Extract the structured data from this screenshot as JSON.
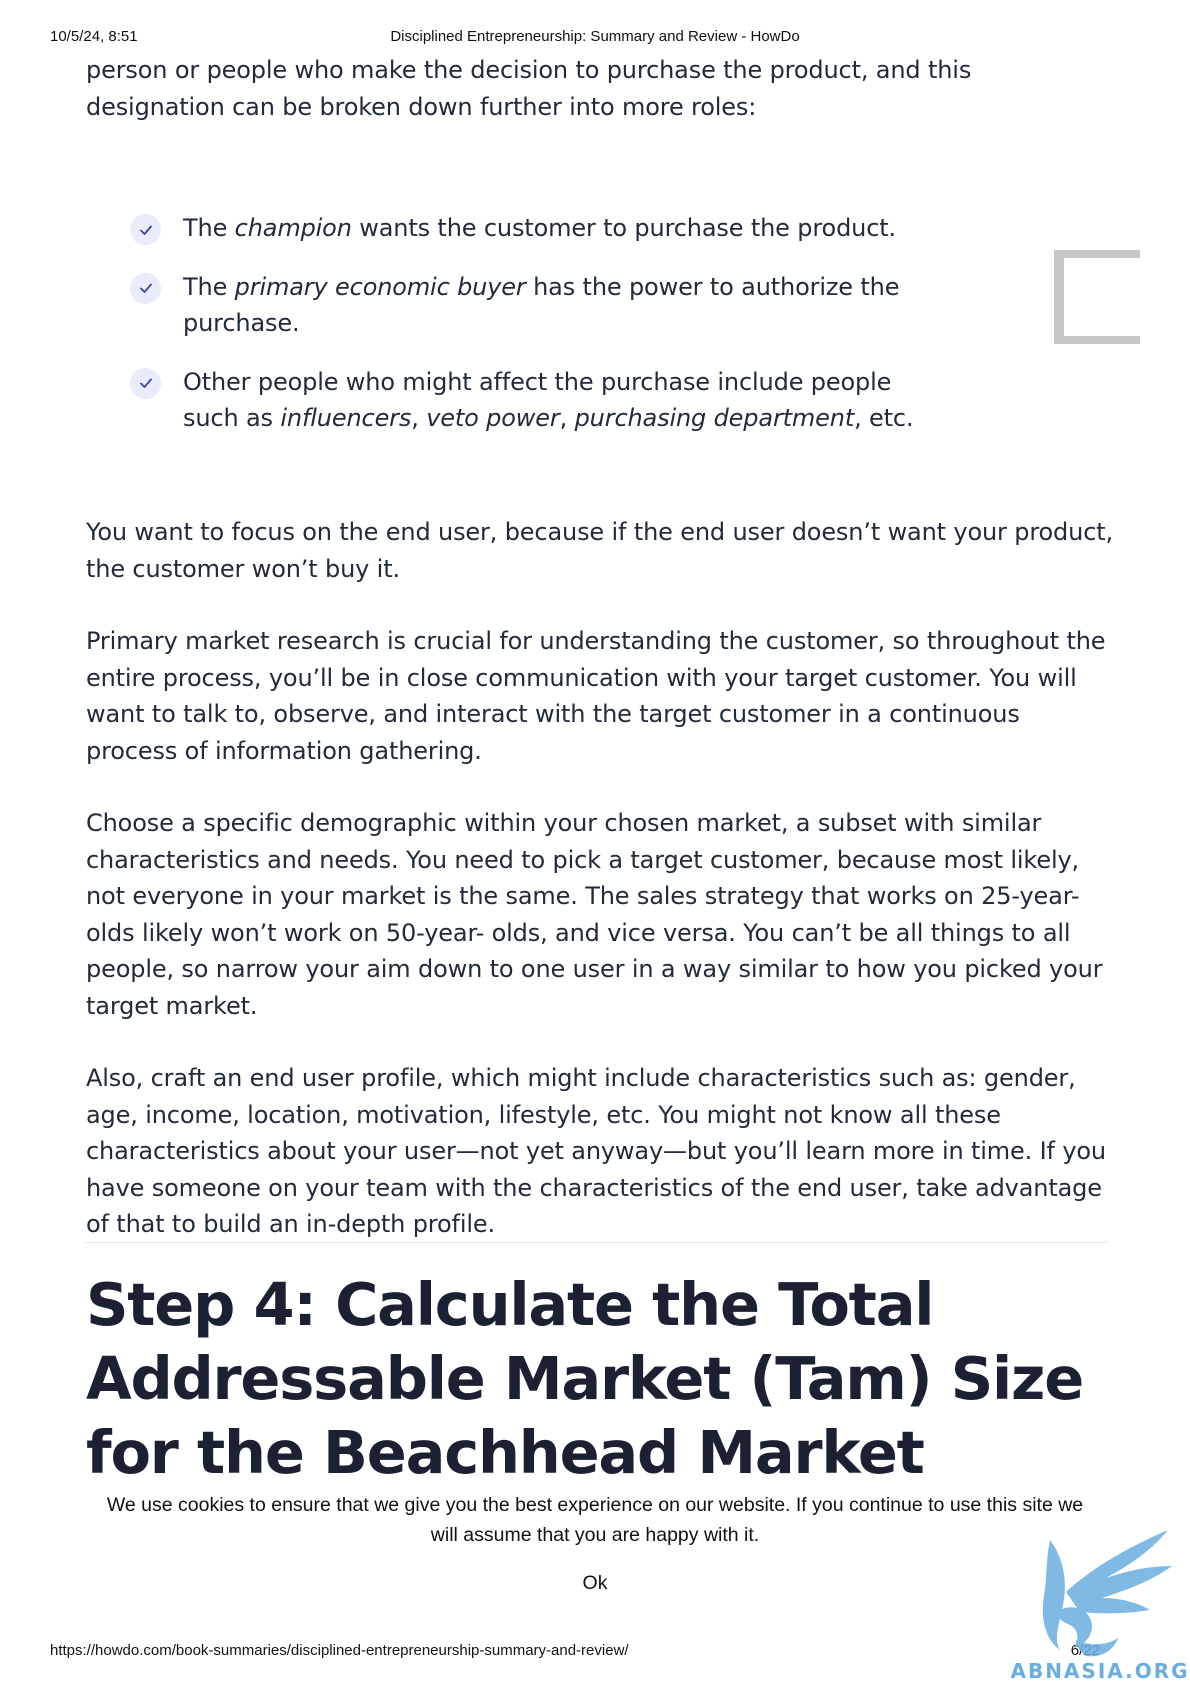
{
  "print_header": {
    "datetime": "10/5/24, 8:51",
    "title": "Disciplined Entrepreneurship: Summary and Review - HowDo"
  },
  "intro": {
    "text": "person or people who make the decision to purchase the product, and this designation can be broken down further into more roles:"
  },
  "checklist": [
    {
      "pre": "The ",
      "em": "champion",
      "post": " wants the customer to purchase the product."
    },
    {
      "pre": "The ",
      "em": "primary economic buyer",
      "post": " has the power to authorize the purchase."
    },
    {
      "pre": "Other people who might affect the purchase include people such as ",
      "em1": "influencers",
      "sep1": ", ",
      "em2": "veto power",
      "sep2": ", ",
      "em3": "purchasing department",
      "post": ", etc."
    }
  ],
  "paragraphs": [
    "You want to focus on the end user, because if the end user doesn’t want your product, the customer won’t buy it.",
    "Primary market research is crucial for understanding the customer, so throughout the entire process, you’ll be in close communication with your target customer. You will want to talk to, observe, and interact with the target customer in a continuous process of information gathering.",
    "Choose a specific demographic within your chosen market, a subset with similar characteristics and needs. You need to pick a target customer, because most likely, not everyone in your market is the same. The sales strategy that works on 25-year- olds likely won’t work on 50-year- olds, and vice versa. You can’t be all things to all people, so narrow your aim down to one user in a way similar to how you picked your target market.",
    "Also, craft an end user profile, which might include characteristics such as: gender, age, income, location, motivation, lifestyle, etc. You might not know all these characteristics about your user—not yet anyway—but you’ll learn more in time. If you have someone on your team with the characteristics of the end user, take advantage of that to build an in-depth profile."
  ],
  "heading": "Step 4: Calculate the Total Addressable Market (Tam) Size for the Beachhead Market",
  "cookie_banner": {
    "message": "We use cookies to ensure that we give you the best experience on our website. If you continue to use this site we will assume that you are happy with it.",
    "ok_label": "Ok"
  },
  "print_footer": {
    "url": "https://howdo.com/book-summaries/disciplined-entrepreneurship-summary-and-review/",
    "page": "6/22"
  },
  "watermark": {
    "text": "ABNASIA.ORG"
  },
  "colors": {
    "text": "#222b3a",
    "heading": "#1b2033",
    "check_bg": "#e9ecfb",
    "check_mark": "#3b45a8",
    "side_box": "#c6c6c6",
    "watermark": "#6aaee0"
  },
  "icons": [
    "check-icon",
    "bookmark-bracket-icon",
    "watermark-logo-icon"
  ]
}
